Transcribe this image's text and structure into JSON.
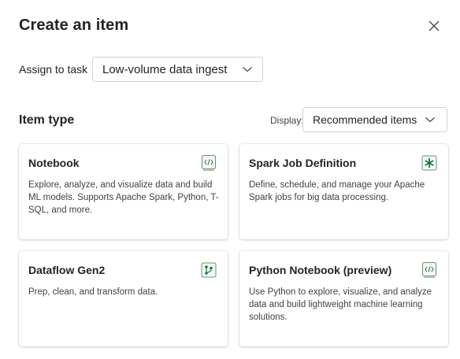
{
  "dialog": {
    "title": "Create an item"
  },
  "assign": {
    "label": "Assign to task",
    "value": "Low-volume data ingest"
  },
  "item_type": {
    "title": "Item type",
    "display_label": "Display:",
    "display_value": "Recommended items"
  },
  "cards": [
    {
      "title": "Notebook",
      "description": "Explore, analyze, and visualize data and build ML models. Supports Apache Spark, Python, T-SQL, and more.",
      "icon": "notebook-icon"
    },
    {
      "title": "Spark Job Definition",
      "description": "Define, schedule, and manage your Apache Spark jobs for big data processing.",
      "icon": "spark-job-icon"
    },
    {
      "title": "Dataflow Gen2",
      "description": "Prep, clean, and transform data.",
      "icon": "dataflow-icon"
    },
    {
      "title": "Python Notebook (preview)",
      "description": "Use Python to explore, visualize, and analyze data and build lightweight machine learning solutions.",
      "icon": "python-notebook-icon"
    }
  ],
  "colors": {
    "accent_green": "#0f7b3f",
    "border": "#d1d1d1",
    "text": "#242424"
  }
}
